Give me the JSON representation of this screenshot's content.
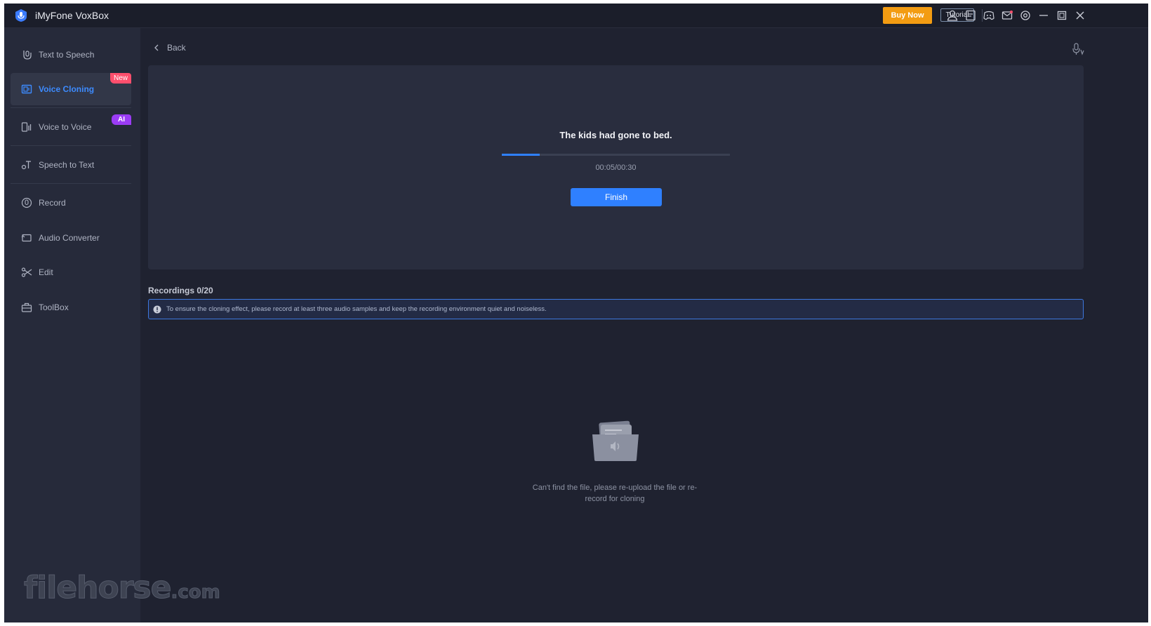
{
  "app": {
    "title": "iMyFone VoxBox",
    "accent": "#2f80ff"
  },
  "titlebar": {
    "buy_now": "Buy Now",
    "tutorial": "Tutorial",
    "icons": [
      "user-icon",
      "feedback-icon",
      "discord-icon",
      "mail-icon",
      "settings-icon",
      "minimize-icon",
      "maximize-icon",
      "close-icon"
    ]
  },
  "sidebar": {
    "items": [
      {
        "label": "Text to Speech",
        "icon": "text-to-speech-icon"
      },
      {
        "label": "Voice Cloning",
        "icon": "voice-cloning-icon",
        "badge": "New",
        "active": true
      },
      {
        "label": "Voice to Voice",
        "icon": "voice-to-voice-icon",
        "badge": "AI"
      },
      {
        "label": "Speech to Text",
        "icon": "speech-to-text-icon"
      },
      {
        "label": "Record",
        "icon": "record-icon"
      },
      {
        "label": "Audio Converter",
        "icon": "audio-converter-icon"
      },
      {
        "label": "Edit",
        "icon": "scissors-icon"
      },
      {
        "label": "ToolBox",
        "icon": "toolbox-icon"
      }
    ],
    "watermark": "filehorse",
    "watermark_suffix": ".com"
  },
  "main": {
    "back_label": "Back",
    "recorder": {
      "sentence": "The kids had gone to bed.",
      "progress_fraction": 0.1667,
      "time": "00:05/00:30",
      "finish_label": "Finish"
    },
    "recordings_title": "Recordings 0/20",
    "notice": "To ensure the cloning effect, please record at least three audio samples and keep the recording environment quiet and noiseless.",
    "empty_text": "Can't find the file, please re-upload the file or re-record for cloning"
  }
}
